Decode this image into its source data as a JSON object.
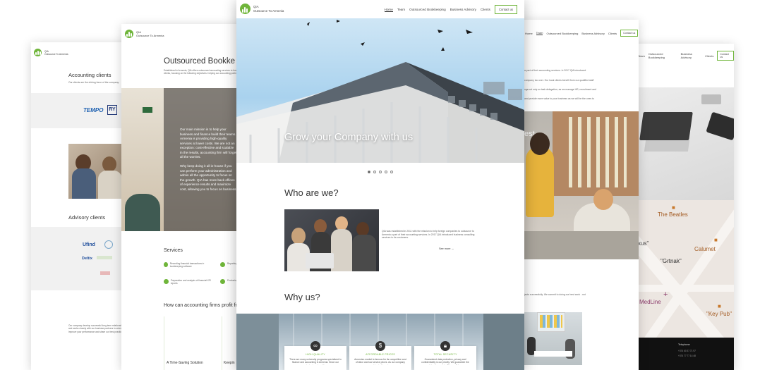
{
  "brand": {
    "name": "QIA",
    "tagline": "Outsource To Armenia"
  },
  "nav": {
    "items": [
      "Home",
      "Team",
      "Outsourced Bookkeeping",
      "Business Advisory",
      "Clients"
    ],
    "contact": "Contact us"
  },
  "hero": {
    "heading": "Grow your Company with us",
    "slides": 5,
    "active_slide": 1
  },
  "who": {
    "heading": "Who are we?",
    "text": "QIA was established in 2011 with the mission to help foreign companies to outsource to Armenia a part of their accounting services. In 2017 QIA introduced business consulting services to its customers.",
    "see_more": "See more →"
  },
  "why": {
    "heading": "Why us?",
    "cards": [
      {
        "icon": "quality-icon",
        "title": "HIGH QUALITY",
        "text": "There are many university programs specialized in finance and accounting in Armenia. Since our students get quality"
      },
      {
        "icon": "dollar-icon",
        "title": "AFFORDABLE PRICES",
        "text": "Armenian market is famous for its competitive cost of labor and low service prices. As our company resides in Armenia,"
      },
      {
        "icon": "lock-icon",
        "title": "TOTAL SECURITY",
        "text": "Guaranteed data protection, privacy and confidentiality is our priority. We guarantee the safety of your data. There will be no"
      }
    ]
  },
  "left_page": {
    "accounting_heading": "Accounting clients",
    "accounting_sub": "Our clients are the driving force of the company.",
    "advisory_heading": "Advisory clients",
    "client_logos": [
      "TEMPO",
      "Ufind",
      "Deltix"
    ],
    "footer_text": "Our company develop successful long term relationships and works closely with our business partners in order to improve your performance and share our best practice."
  },
  "page2": {
    "heading": "Outsourced Bookke",
    "intro": "Established in Armenia, QIA offers outsourced accounting services to foreign clients, focusing on the following objectives: helping our accounting partners",
    "overlay_p1": "Our main mission is to help your business and finance build their teams. Armenia is providing high-quality services at lower costs. We are not an exception: cost-effective and scalable in the results, accounting firm will forget all the worries.",
    "overlay_p2": "Why keep doing it all in-house if you can perform your administration and admin all the opportunity to focus on the growth. QIA has more back offices of experience results and maximize cost, allowing you to focus on business.",
    "services_heading": "Services",
    "services": [
      "Recording financial transactions in bookkeeping software",
      "Reporting to management",
      "Preparation and analysis of financial KPI reports",
      "Producing financial statements"
    ],
    "profit_heading": "How can accounting firms profit fr",
    "time_saving": "A Time-Saving Solution",
    "keeping": "Keepin"
  },
  "page4": {
    "nav": [
      "Home",
      "Team",
      "Outsourced Bookkeeping",
      "Business Advisory",
      "Clients"
    ],
    "contact": "Contact us",
    "text_lines": [
      "a part of their accounting services. In 2017 QIA introduced",
      "company too over. Our local clients benefit from our qualified staff",
      "ngs not only on task delegation, as we manage HR, recruitment and",
      "and provide more value to your business as we will be the ones to"
    ],
    "bottom_text": "jects successfully. We commit to doing our best work - not",
    "est_label": "est"
  },
  "page5": {
    "nav": [
      "Team",
      "Outsourced Bookkeeping",
      "Business Advisory",
      "Clients"
    ],
    "map_labels": [
      "The Beatles",
      "xus\"",
      "Calumet",
      "\"Grtnak\"",
      "MedLine",
      "\"Key Pub\""
    ],
    "footer_title": "Telephone",
    "footer_lines": [
      "+374 60 37 71 97",
      "+374 77 77 14 48"
    ]
  }
}
